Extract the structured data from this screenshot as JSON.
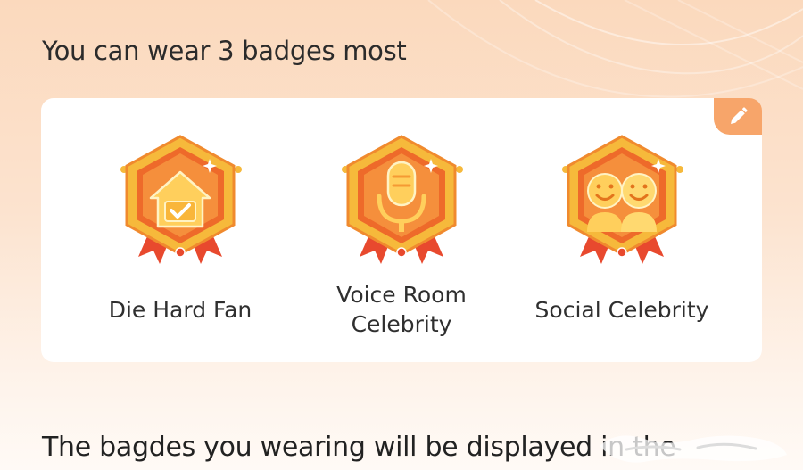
{
  "heading": "You can wear 3 badges most",
  "edit": {
    "icon": "pencil-icon",
    "color": "#f7a56a"
  },
  "badges": [
    {
      "label": "Die Hard Fan",
      "icon": "house-check-icon"
    },
    {
      "label": "Voice Room Celebrity",
      "icon": "microphone-icon"
    },
    {
      "label": "Social Celebrity",
      "icon": "two-smiley-faces-icon"
    }
  ],
  "footer_text": "The bagdes you wearing will be displayed in the",
  "colors": {
    "badge_gold": "#f6b93b",
    "badge_orange": "#ee6a2a",
    "ribbon_red": "#e8492e"
  }
}
